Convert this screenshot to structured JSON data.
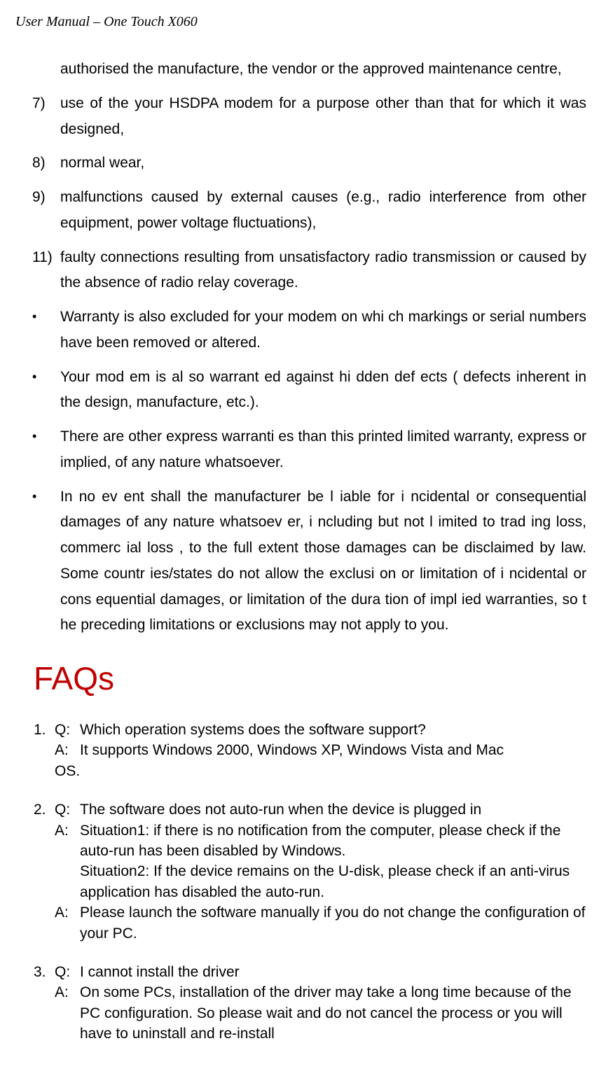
{
  "header": "User Manual – One Touch X060",
  "list_continuation": "authorised the manufacture, the vendor or the approved maintenance centre,",
  "numbered_items": [
    {
      "num": "7)",
      "text": "use of the your HSDPA modem for a purpose other than that for which it was designed,"
    },
    {
      "num": "8)",
      "text": "normal wear,"
    },
    {
      "num": "9)",
      "text": "malfunctions caused by external causes (e.g., radio interference from other equipment, power voltage fluctuations),"
    },
    {
      "num": "11)",
      "text": "faulty connections resulting from unsatisfactory radio transmission or caused by the absence of radio relay coverage."
    }
  ],
  "bullet_items": [
    "Warranty is also excluded for your modem on whi ch markings or serial numbers have been removed or altered.",
    "Your mod em is al so warrant ed against hi dden def ects ( defects inherent in the design, manufacture, etc.).",
    "There are other express warranti es than this printed limited warranty, express or implied, of any nature whatsoever.",
    "In no ev ent shall the manufacturer be l iable for i ncidental or consequential damages of any nature whatsoev er, i ncluding but not l imited to trad ing loss, commerc ial loss , to the full extent those damages can be disclaimed by law. Some countr ies/states do not allow the exclusi on or limitation of i ncidental or cons equential damages, or limitation of the dura tion of impl ied warranties, so t he preceding limitations or exclusions may not apply to you."
  ],
  "faqs_heading": "FAQs",
  "faqs": [
    {
      "num": "1.",
      "q_label": "Q:",
      "q_text": "Which operation systems does the software support?",
      "a_label": "A:",
      "a_text": "It supports Windows 2000, Windows XP, Windows Vista and Mac",
      "a_continue": "OS."
    },
    {
      "num": "2.",
      "q_label": "Q:",
      "q_text": "The software does not auto-run when the device is plugged in",
      "answers": [
        {
          "label": "A:",
          "text": "Situation1: if there is no notification from the computer, please check if the auto-run has been disabled by Windows.",
          "extra": "Situation2: If the device remains on the U-disk, please check if an anti-virus application has disabled the auto-run."
        },
        {
          "label": "A:",
          "text": "Please launch the software manually if you do not change the configuration of your PC."
        }
      ]
    },
    {
      "num": "3.",
      "q_label": "Q:",
      "q_text": "I cannot install the driver",
      "a_label": "A:",
      "a_text": "On some PCs, installation of the driver may take a long time because of the PC configuration. So please wait and do not cancel the process or you will have to uninstall and re-install"
    }
  ]
}
